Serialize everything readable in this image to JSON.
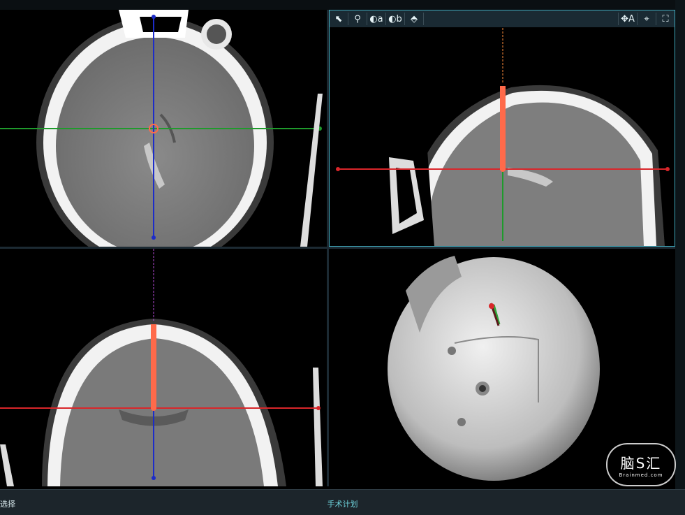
{
  "toolbar": {
    "tools": [
      {
        "name": "pointer-icon",
        "glyph": "⬉"
      },
      {
        "name": "zoom-icon",
        "glyph": "⚲"
      },
      {
        "name": "window-a-icon",
        "glyph": "◐a"
      },
      {
        "name": "window-b-icon",
        "glyph": "◐b"
      },
      {
        "name": "ruler-icon",
        "glyph": "⬘"
      }
    ],
    "right_tools": [
      {
        "name": "pan-icon",
        "glyph": "✥A"
      },
      {
        "name": "crosshair-icon",
        "glyph": "⌖"
      },
      {
        "name": "fullscreen-icon",
        "glyph": "⛶"
      }
    ]
  },
  "status": {
    "left": "选择",
    "center": "手术计划"
  },
  "watermark": {
    "main": "脑S汇",
    "sub": "Brainmed.com"
  },
  "colors": {
    "accent": "#3fa6b8",
    "crosshair_red": "#d9262a",
    "crosshair_green": "#1f9a2c",
    "crosshair_blue": "#1c2cc9",
    "trajectory": "#ff6a4a"
  }
}
